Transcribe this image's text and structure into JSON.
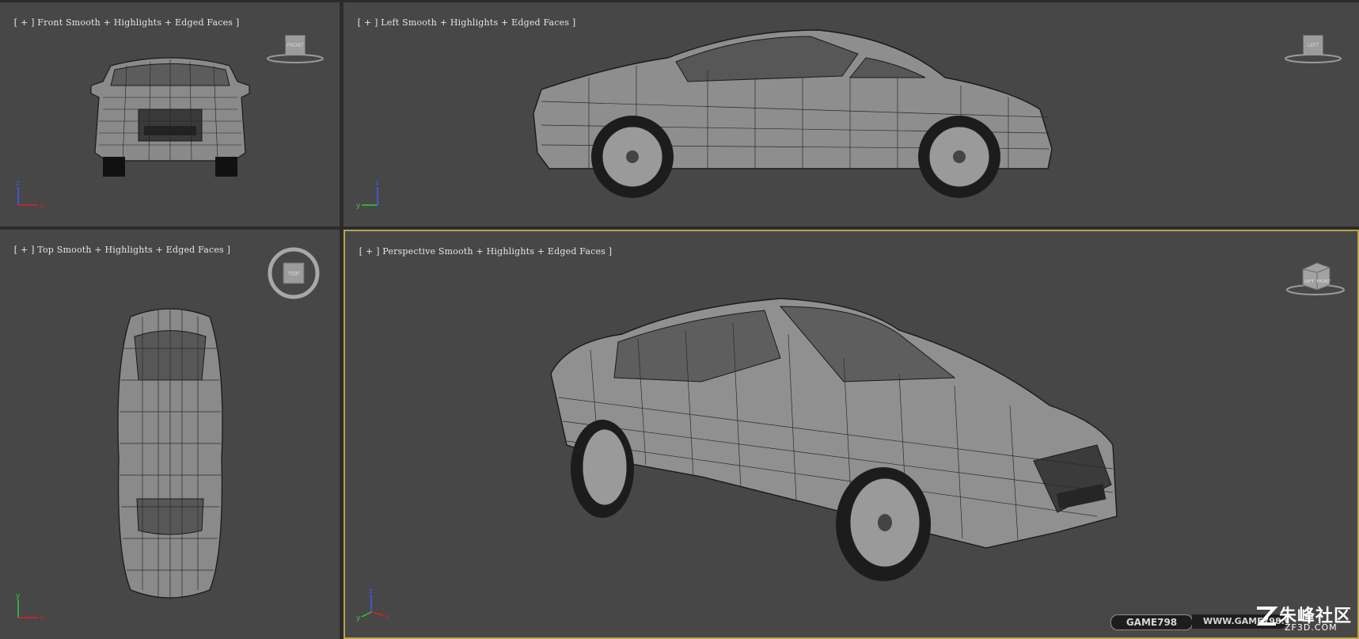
{
  "viewports": {
    "front": {
      "label_bracket_open": "[ + ]",
      "view": "Front",
      "shading": "Smooth + Highlights + Edged Faces ]",
      "cube_label": "FRONT"
    },
    "left": {
      "label_bracket_open": "[ + ]",
      "view": "Left",
      "shading": "Smooth + Highlights + Edged Faces ]",
      "cube_label": "LEFT"
    },
    "top": {
      "label_bracket_open": "[ + ]",
      "view": "Top",
      "shading": "Smooth + Highlights + Edged Faces ]",
      "cube_label": "TOP"
    },
    "perspective": {
      "label_bracket_open": "[ + ]",
      "view": "Perspective",
      "shading": "Smooth + Highlights + Edged Faces ]",
      "cube_label_left": "LEFT",
      "cube_label_front": "FRONT",
      "active": true
    }
  },
  "axis": {
    "x": "x",
    "y": "y",
    "z": "z"
  },
  "watermark": {
    "badge": "GAME798",
    "site": "WWW.GAME798.COM",
    "brand_cn": "朱峰社区",
    "brand_url": "ZF3D.COM"
  },
  "colors": {
    "viewport_bg": "#474747",
    "active_border": "#b7a648",
    "frame_bg": "#2b2b2b",
    "label_text": "#e6e6e6"
  }
}
